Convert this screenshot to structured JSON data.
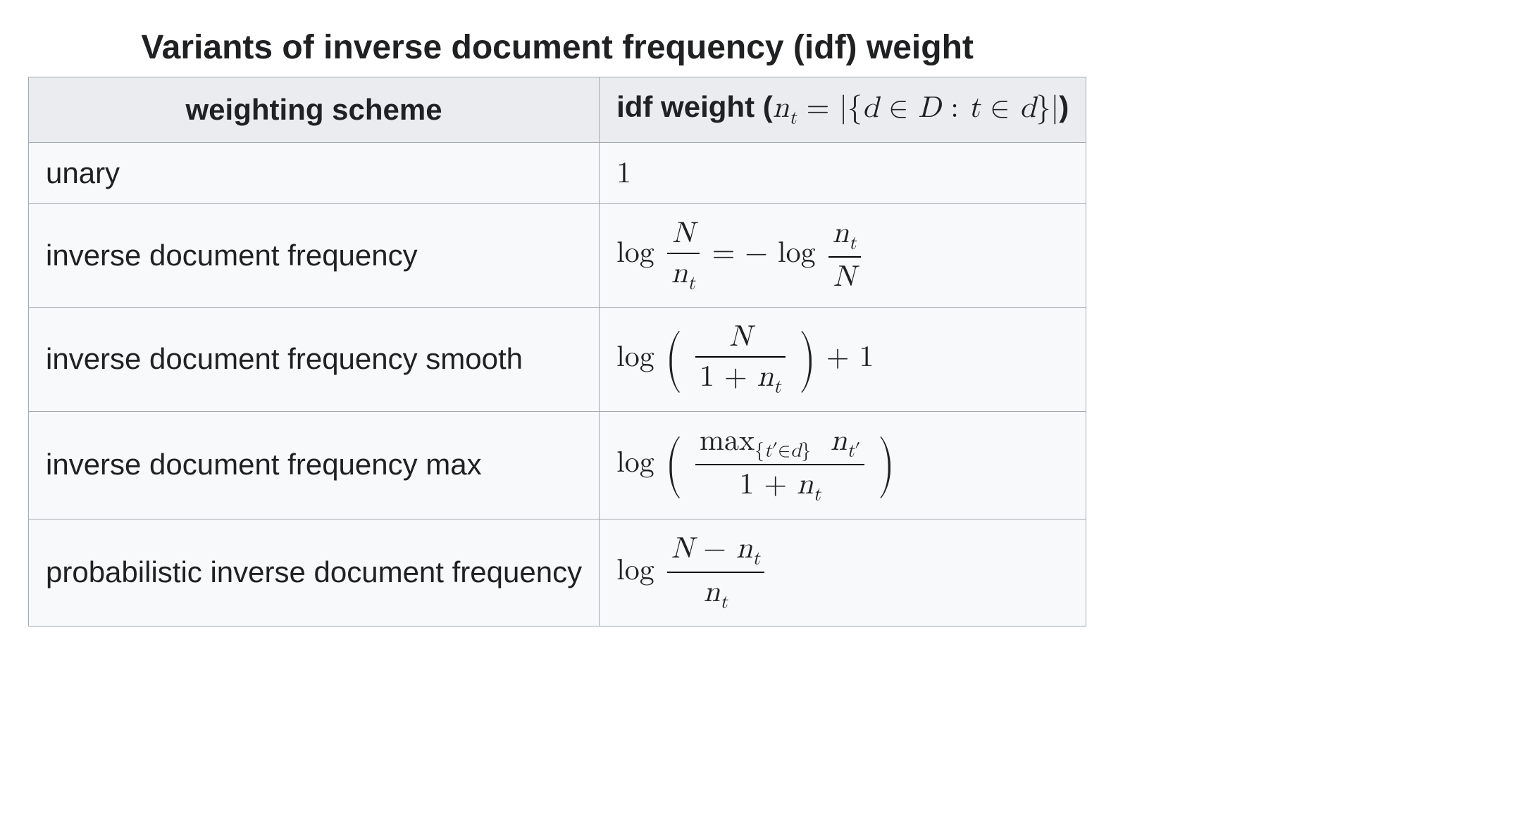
{
  "table": {
    "caption": "Variants of inverse document frequency (idf) weight",
    "headers": {
      "scheme": "weighting scheme",
      "idf_prefix": "idf weight ("
    },
    "rows": [
      {
        "scheme": "unary",
        "weight_text": "1"
      },
      {
        "scheme": "inverse document frequency"
      },
      {
        "scheme": "inverse document frequency smooth"
      },
      {
        "scheme": "inverse document frequency max"
      },
      {
        "scheme": "probabilistic inverse document frequency"
      }
    ]
  },
  "math": {
    "n_t": "n",
    "n_t_sub": "t",
    "header_def_lhs_eq": " = ",
    "header_set_open": "|{",
    "header_d": "d",
    "header_in": " ∈ ",
    "header_D": "D",
    "header_colon": " : ",
    "header_t": "t",
    "header_in2": " ∈ ",
    "header_d2": "d",
    "header_set_close": "}|",
    "header_close_paren": ")",
    "log": "log",
    "N": "N",
    "eq": " = ",
    "minus": "−",
    "minus_sp": " − ",
    "plus1_trail": " + 1",
    "one_plus": "1 + ",
    "max": "max",
    "max_sub_open": "{",
    "max_sub_t": "t",
    "max_sub_prime": "′",
    "max_sub_in": "∈",
    "max_sub_d": "d",
    "max_sub_close": "}",
    "nt_prime_n": "n",
    "nt_prime_t": "t",
    "nt_prime_mark": "′"
  }
}
